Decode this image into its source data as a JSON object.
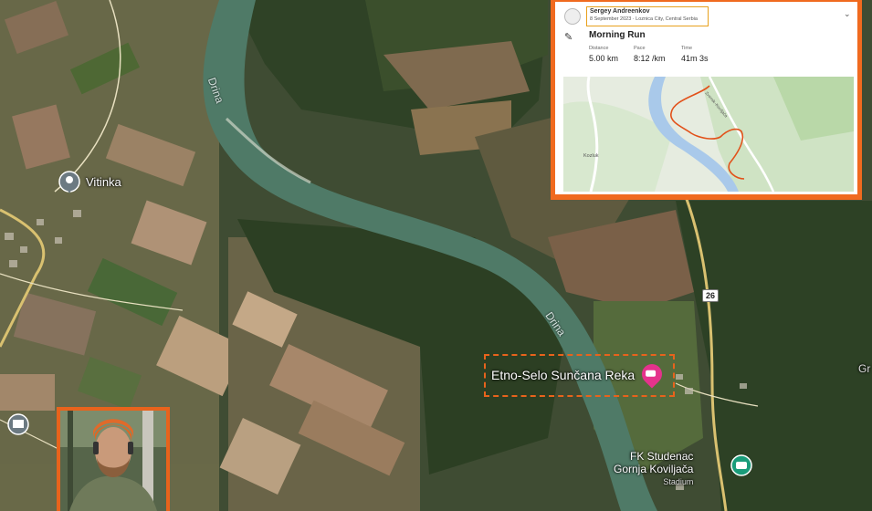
{
  "map": {
    "river_name_1": "Drina",
    "river_name_2": "Drina",
    "places": {
      "vitinka": "Vitinka",
      "hotel": "Etno-Selo Sunčana Reka",
      "stadium_line1": "FK Studenac",
      "stadium_line2": "Gornja Koviljača",
      "stadium_line3": "Stadium",
      "right_edge": "Gr"
    },
    "road_shield": "26",
    "colors": {
      "highlight": "#e8631c",
      "hotel_pin": "#e5328c",
      "stadium_pin": "#1a9c7a"
    }
  },
  "activity": {
    "athlete": "Sergey Andreenkov",
    "date_location": "8 September 2023 · Loznica City, Central Serbia",
    "title": "Morning Run",
    "stats": [
      {
        "label": "Distance",
        "value": "5.00 km"
      },
      {
        "label": "Pace",
        "value": "8:12 /km"
      },
      {
        "label": "Time",
        "value": "41m 3s"
      }
    ],
    "mini_map": {
      "town": "Kozluk",
      "road_label": "Zvornik–Koviljača"
    },
    "icons": [
      "shoe-icon",
      "chevron-down-icon",
      "avatar-icon"
    ],
    "route_color": "#e2511a"
  }
}
